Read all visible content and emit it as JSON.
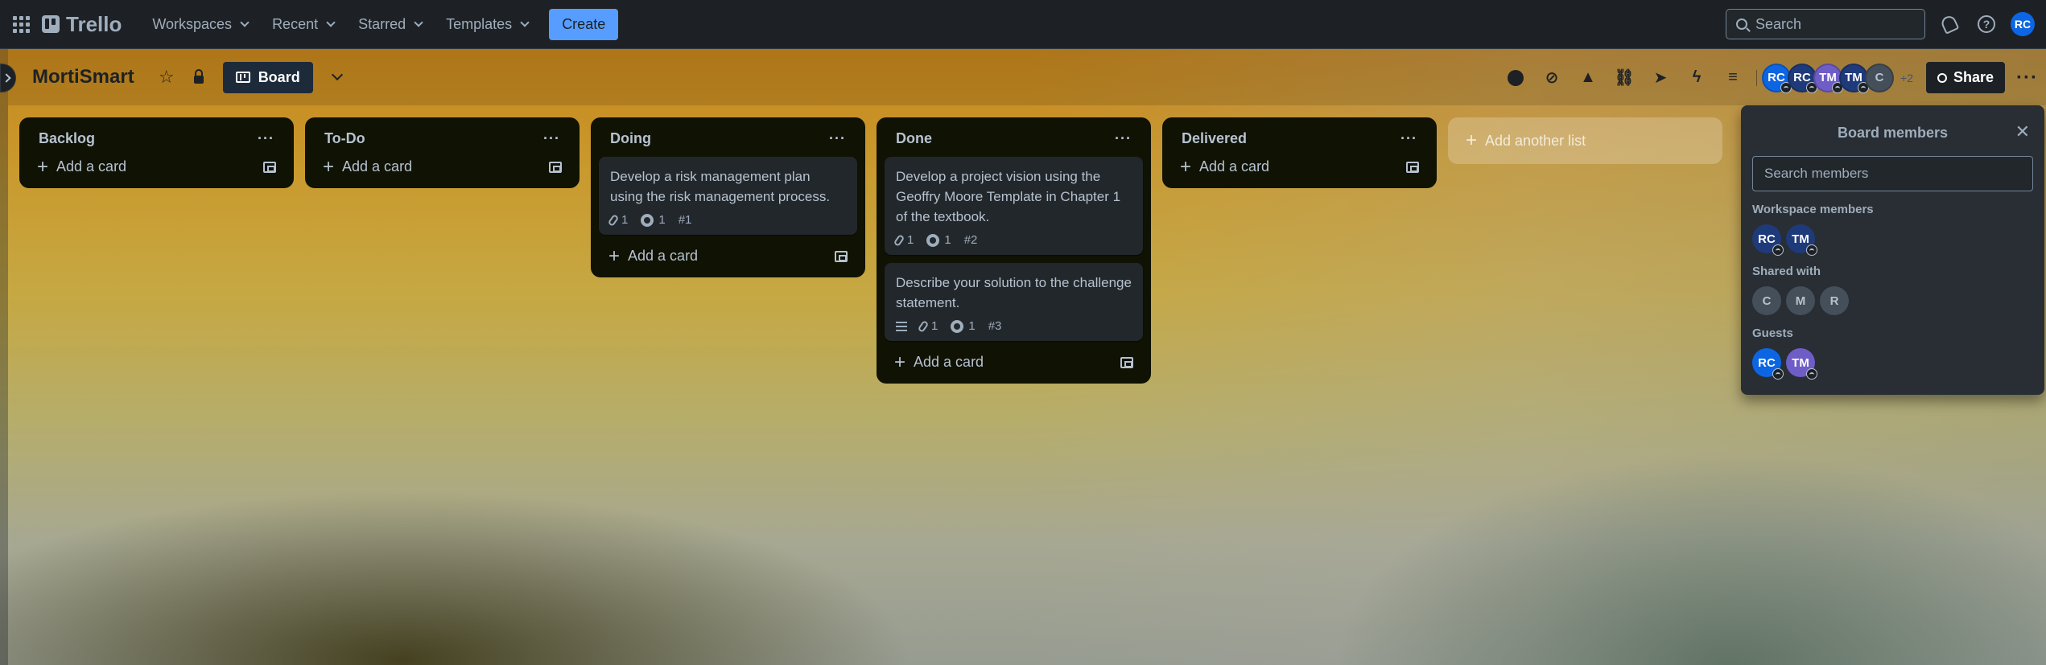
{
  "nav": {
    "logo": "Trello",
    "menus": [
      "Workspaces",
      "Recent",
      "Starred",
      "Templates"
    ],
    "create": "Create",
    "search_placeholder": "Search",
    "user_initials": "RC"
  },
  "board": {
    "title": "MortiSmart",
    "view": "Board",
    "members": [
      "RC",
      "RC",
      "TM",
      "TM",
      "C"
    ],
    "more_count": "+2",
    "share": "Share"
  },
  "colors": {
    "member_blue": "#0c66e4",
    "member_navy": "#1f3a7a",
    "member_purple": "#6e5dc6",
    "member_gray": "#454f59"
  },
  "lists": [
    {
      "title": "Backlog",
      "cards": [],
      "add": "Add a card"
    },
    {
      "title": "To-Do",
      "cards": [],
      "add": "Add a card"
    },
    {
      "title": "Doing",
      "cards": [
        {
          "title": "Develop a risk management plan using the risk management process.",
          "attachments": "1",
          "github": "1",
          "number": "#1",
          "description": false
        }
      ],
      "add": "Add a card"
    },
    {
      "title": "Done",
      "cards": [
        {
          "title": "Develop a project vision using the Geoffry Moore Template in Chapter 1 of the textbook.",
          "attachments": "1",
          "github": "1",
          "number": "#2",
          "description": false
        },
        {
          "title": "Describe your solution to the challenge statement.",
          "attachments": "1",
          "github": "1",
          "number": "#3",
          "description": true
        }
      ],
      "add": "Add a card"
    },
    {
      "title": "Delivered",
      "cards": [],
      "add": "Add a card"
    }
  ],
  "add_list": "Add another list",
  "members_panel": {
    "title": "Board members",
    "search_placeholder": "Search members",
    "workspace_label": "Workspace members",
    "workspace": [
      "RC",
      "TM"
    ],
    "shared_label": "Shared with",
    "shared": [
      "C",
      "M",
      "R"
    ],
    "guests_label": "Guests",
    "guests": [
      "RC",
      "TM"
    ]
  }
}
